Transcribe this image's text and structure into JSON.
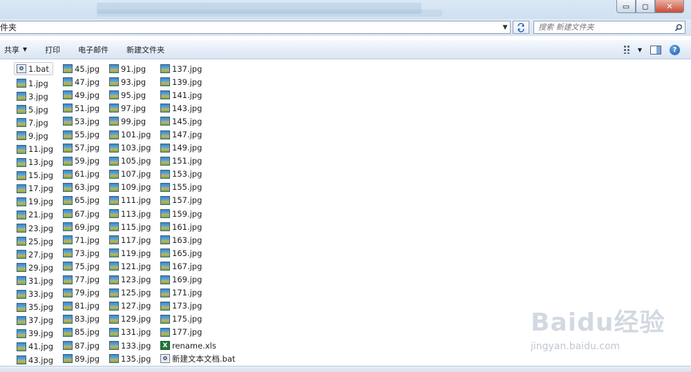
{
  "window": {
    "minimize_label": "▭",
    "maximize_label": "◻",
    "close_label": "✕"
  },
  "address": {
    "path_text": "件夹"
  },
  "search": {
    "placeholder": "搜索 新建文件夹"
  },
  "toolbar": {
    "share_label": "共享",
    "print_label": "打印",
    "email_label": "电子邮件",
    "new_folder_label": "新建文件夹"
  },
  "files": {
    "column1": [
      {
        "name": "1.bat",
        "type": "bat"
      },
      {
        "name": "1.jpg",
        "type": "jpg"
      },
      {
        "name": "3.jpg",
        "type": "jpg"
      },
      {
        "name": "5.jpg",
        "type": "jpg"
      },
      {
        "name": "7.jpg",
        "type": "jpg"
      },
      {
        "name": "9.jpg",
        "type": "jpg"
      },
      {
        "name": "11.jpg",
        "type": "jpg"
      },
      {
        "name": "13.jpg",
        "type": "jpg"
      },
      {
        "name": "15.jpg",
        "type": "jpg"
      },
      {
        "name": "17.jpg",
        "type": "jpg"
      },
      {
        "name": "19.jpg",
        "type": "jpg"
      },
      {
        "name": "21.jpg",
        "type": "jpg"
      },
      {
        "name": "23.jpg",
        "type": "jpg"
      },
      {
        "name": "25.jpg",
        "type": "jpg"
      },
      {
        "name": "27.jpg",
        "type": "jpg"
      },
      {
        "name": "29.jpg",
        "type": "jpg"
      },
      {
        "name": "31.jpg",
        "type": "jpg"
      },
      {
        "name": "33.jpg",
        "type": "jpg"
      },
      {
        "name": "35.jpg",
        "type": "jpg"
      },
      {
        "name": "37.jpg",
        "type": "jpg"
      },
      {
        "name": "39.jpg",
        "type": "jpg"
      },
      {
        "name": "41.jpg",
        "type": "jpg"
      },
      {
        "name": "43.jpg",
        "type": "jpg"
      }
    ],
    "column2": [
      {
        "name": "45.jpg",
        "type": "jpg"
      },
      {
        "name": "47.jpg",
        "type": "jpg"
      },
      {
        "name": "49.jpg",
        "type": "jpg"
      },
      {
        "name": "51.jpg",
        "type": "jpg"
      },
      {
        "name": "53.jpg",
        "type": "jpg"
      },
      {
        "name": "55.jpg",
        "type": "jpg"
      },
      {
        "name": "57.jpg",
        "type": "jpg"
      },
      {
        "name": "59.jpg",
        "type": "jpg"
      },
      {
        "name": "61.jpg",
        "type": "jpg"
      },
      {
        "name": "63.jpg",
        "type": "jpg"
      },
      {
        "name": "65.jpg",
        "type": "jpg"
      },
      {
        "name": "67.jpg",
        "type": "jpg"
      },
      {
        "name": "69.jpg",
        "type": "jpg"
      },
      {
        "name": "71.jpg",
        "type": "jpg"
      },
      {
        "name": "73.jpg",
        "type": "jpg"
      },
      {
        "name": "75.jpg",
        "type": "jpg"
      },
      {
        "name": "77.jpg",
        "type": "jpg"
      },
      {
        "name": "79.jpg",
        "type": "jpg"
      },
      {
        "name": "81.jpg",
        "type": "jpg"
      },
      {
        "name": "83.jpg",
        "type": "jpg"
      },
      {
        "name": "85.jpg",
        "type": "jpg"
      },
      {
        "name": "87.jpg",
        "type": "jpg"
      },
      {
        "name": "89.jpg",
        "type": "jpg"
      }
    ],
    "column3": [
      {
        "name": "91.jpg",
        "type": "jpg"
      },
      {
        "name": "93.jpg",
        "type": "jpg"
      },
      {
        "name": "95.jpg",
        "type": "jpg"
      },
      {
        "name": "97.jpg",
        "type": "jpg"
      },
      {
        "name": "99.jpg",
        "type": "jpg"
      },
      {
        "name": "101.jpg",
        "type": "jpg"
      },
      {
        "name": "103.jpg",
        "type": "jpg"
      },
      {
        "name": "105.jpg",
        "type": "jpg"
      },
      {
        "name": "107.jpg",
        "type": "jpg"
      },
      {
        "name": "109.jpg",
        "type": "jpg"
      },
      {
        "name": "111.jpg",
        "type": "jpg"
      },
      {
        "name": "113.jpg",
        "type": "jpg"
      },
      {
        "name": "115.jpg",
        "type": "jpg"
      },
      {
        "name": "117.jpg",
        "type": "jpg"
      },
      {
        "name": "119.jpg",
        "type": "jpg"
      },
      {
        "name": "121.jpg",
        "type": "jpg"
      },
      {
        "name": "123.jpg",
        "type": "jpg"
      },
      {
        "name": "125.jpg",
        "type": "jpg"
      },
      {
        "name": "127.jpg",
        "type": "jpg"
      },
      {
        "name": "129.jpg",
        "type": "jpg"
      },
      {
        "name": "131.jpg",
        "type": "jpg"
      },
      {
        "name": "133.jpg",
        "type": "jpg"
      },
      {
        "name": "135.jpg",
        "type": "jpg"
      }
    ],
    "column4": [
      {
        "name": "137.jpg",
        "type": "jpg"
      },
      {
        "name": "139.jpg",
        "type": "jpg"
      },
      {
        "name": "141.jpg",
        "type": "jpg"
      },
      {
        "name": "143.jpg",
        "type": "jpg"
      },
      {
        "name": "145.jpg",
        "type": "jpg"
      },
      {
        "name": "147.jpg",
        "type": "jpg"
      },
      {
        "name": "149.jpg",
        "type": "jpg"
      },
      {
        "name": "151.jpg",
        "type": "jpg"
      },
      {
        "name": "153.jpg",
        "type": "jpg"
      },
      {
        "name": "155.jpg",
        "type": "jpg"
      },
      {
        "name": "157.jpg",
        "type": "jpg"
      },
      {
        "name": "159.jpg",
        "type": "jpg"
      },
      {
        "name": "161.jpg",
        "type": "jpg"
      },
      {
        "name": "163.jpg",
        "type": "jpg"
      },
      {
        "name": "165.jpg",
        "type": "jpg"
      },
      {
        "name": "167.jpg",
        "type": "jpg"
      },
      {
        "name": "169.jpg",
        "type": "jpg"
      },
      {
        "name": "171.jpg",
        "type": "jpg"
      },
      {
        "name": "173.jpg",
        "type": "jpg"
      },
      {
        "name": "175.jpg",
        "type": "jpg"
      },
      {
        "name": "177.jpg",
        "type": "jpg"
      },
      {
        "name": "rename.xls",
        "type": "xls"
      },
      {
        "name": "新建文本文档.bat",
        "type": "bat"
      }
    ]
  },
  "selected_file": "1.bat",
  "watermark": {
    "logo_text": "Baidu经验",
    "url_text": "jingyan.baidu.com"
  },
  "colors": {
    "toolbar_bg": "#e3ecf7",
    "selection_border": "#c7cfd8",
    "help_blue": "#1b5ab0"
  }
}
